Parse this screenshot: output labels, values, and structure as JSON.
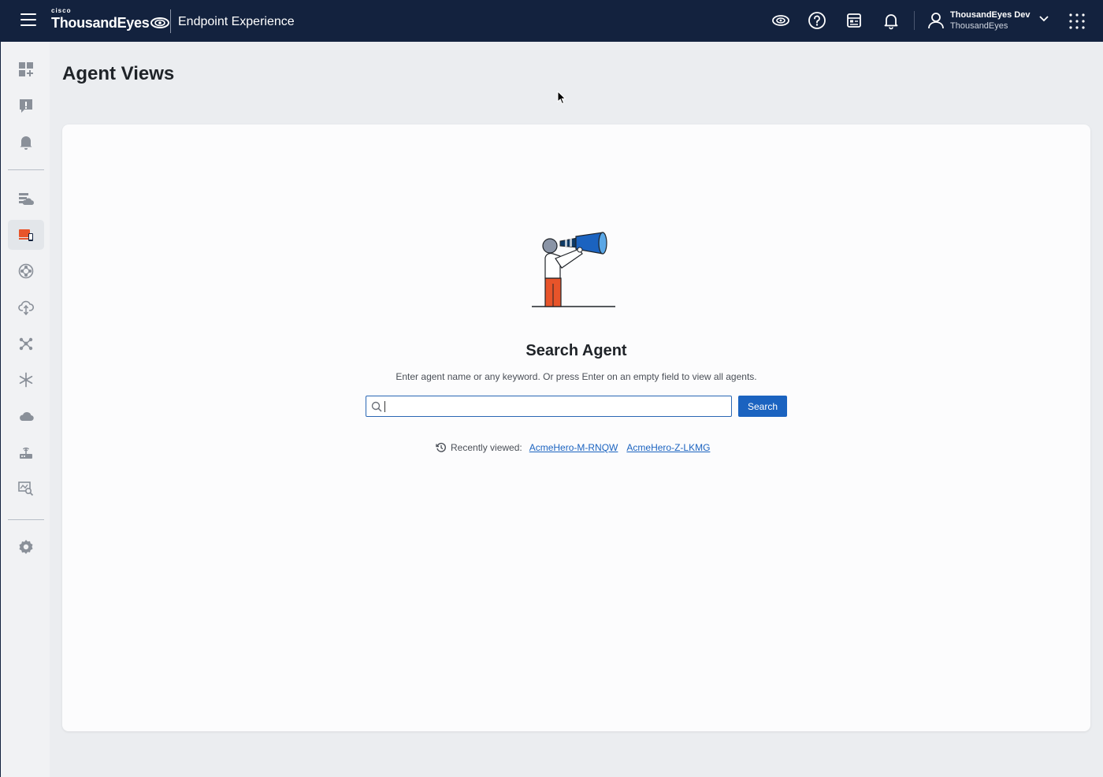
{
  "header": {
    "cisco_label": "cisco",
    "brand": "ThousandEyes",
    "product": "Endpoint Experience",
    "user_name": "ThousandEyes Dev",
    "user_org": "ThousandEyes",
    "bg_color": "#13223e"
  },
  "header_icons": [
    "eye-icon",
    "help-icon",
    "calendar-icon",
    "bell-icon",
    "user-icon",
    "chevron-down-icon",
    "app-grid-icon"
  ],
  "sidebar": {
    "items": [
      {
        "icon": "dashboard-add-icon"
      },
      {
        "icon": "alert-icon"
      },
      {
        "icon": "bell-icon"
      },
      {
        "icon": "cloud-agents-icon"
      },
      {
        "icon": "endpoint-devices-icon",
        "active": true
      },
      {
        "icon": "network-icon"
      },
      {
        "icon": "cloud-upload-icon"
      },
      {
        "icon": "topology-icon"
      },
      {
        "icon": "asterisk-icon"
      },
      {
        "icon": "cloud-icon"
      },
      {
        "icon": "router-icon"
      },
      {
        "icon": "search-chart-icon"
      },
      {
        "icon": "settings-icon"
      }
    ],
    "active_color": "#e8542a"
  },
  "main": {
    "title": "Agent Views"
  },
  "search_card": {
    "title": "Search Agent",
    "hint": "Enter agent name or any keyword. Or press Enter on an empty field to view all agents.",
    "input_value": "",
    "button_label": "Search",
    "recent_label": "Recently viewed:",
    "recent_items": [
      "AcmeHero-M-RNQW",
      "AcmeHero-Z-LKMG"
    ],
    "accent_color": "#1b63c0"
  }
}
